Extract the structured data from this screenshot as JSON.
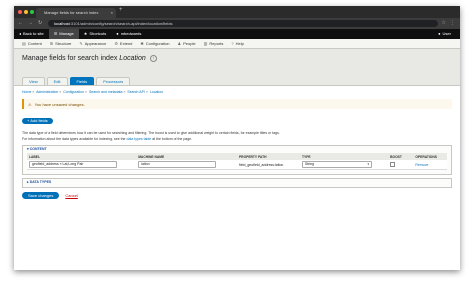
{
  "browser": {
    "tab_title": "Manage fields for search index",
    "tab_close": "×",
    "new_tab": "+",
    "url_host": "localhost",
    "url_path": ":3101/admin/config/search/search-api/index/location/fields",
    "traffic_lights": [
      "#ff5f57",
      "#febc2e",
      "#28c840"
    ]
  },
  "toolbar": {
    "back_label": "Back to site",
    "manage_label": "Manage",
    "shortcuts_label": "Shortcuts",
    "user_link": "mbedwards",
    "user_label": "User"
  },
  "admin_menu": {
    "items": [
      "Content",
      "Structure",
      "Appearance",
      "Extend",
      "Configuration",
      "People",
      "Reports",
      "Help"
    ]
  },
  "page": {
    "title_prefix": "Manage fields for search index",
    "title_italic": "Location",
    "tabs": [
      "View",
      "Edit",
      "Fields",
      "Processors"
    ],
    "active_tab": 2
  },
  "breadcrumb": [
    "Home",
    "Administration",
    "Configuration",
    "Search and metadata",
    "Search API",
    "Location"
  ],
  "warning": {
    "text": "You have unsaved changes.",
    "color": "#e09600"
  },
  "add_fields_label": "+ Add fields",
  "description": {
    "line1": "The data type of a field determines how it can be used for searching and filtering. The boost is used to give additional weight to certain fields, for example titles or tags.",
    "line2_pre": "For information about the data types available for indexing, see the",
    "line2_link": "data types table",
    "line2_post": "at the bottom of the page."
  },
  "content_section": {
    "legend": "▾ CONTENT",
    "columns": [
      "LABEL",
      "MACHINE NAME",
      "PROPERTY PATH",
      "TYPE",
      "BOOST",
      "OPERATIONS"
    ],
    "rows": [
      {
        "label": "geofield_address » Lat,Long Pair",
        "machine_name": "latlon",
        "property_path": "field_geofield_address:latlon",
        "type": "String",
        "operation": "Remove"
      }
    ]
  },
  "data_types_legend": "▸ DATA TYPES",
  "actions": {
    "save_label": "Save changes",
    "cancel_label": "Cancel"
  }
}
